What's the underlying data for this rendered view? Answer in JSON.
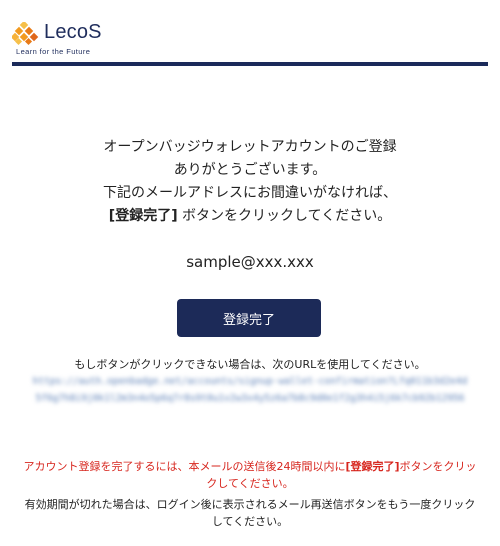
{
  "brand": {
    "name": "LecoS",
    "tagline": "Learn for the Future",
    "colors": {
      "navy": "#1c2a58",
      "orange": "#f29a1f",
      "warning": "#d7261e"
    }
  },
  "message": {
    "line1": "オープンバッジウォレットアカウントのご登録",
    "line2": "ありがとうございます。",
    "line3": "下記のメールアドレスにお間違いがなければ、",
    "line4_bold": "[登録完了]",
    "line4_rest": " ボタンをクリックしてください。"
  },
  "email": "sample@xxx.xxx",
  "confirm_button": {
    "label": "登録完了"
  },
  "fallback": {
    "note": "もしボタンがクリックできない場合は、次のURLを使用してください。",
    "url": "https://auth.openbadge.net/accounts/signup-wallet-confirmation?Lfq011b3d2e4d5f6g7h8i9j0k1l2m3n4o5p6q7r8s9t0u1v2w3x4y5z6a7b8c9d0e1f2g3h4i5j6k7cb92b12956"
  },
  "warning": {
    "prefix": "アカウント登録を完了するには、本メールの送信後24時間以内に",
    "bold": "[登録完了]",
    "suffix": "ボタンをクリックしてください。"
  },
  "expired_note": "有効期間が切れた場合は、ログイン後に表示されるメール再送信ボタンをもう一度クリックしてください。"
}
